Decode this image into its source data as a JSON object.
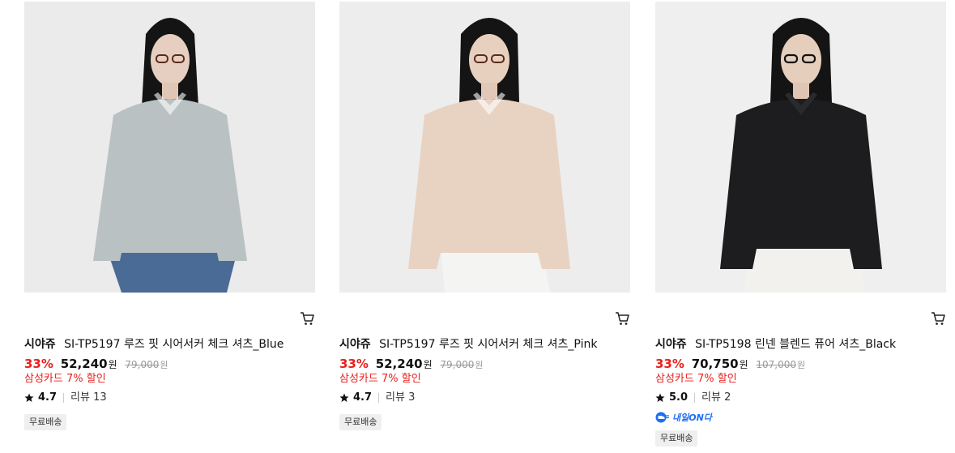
{
  "products": [
    {
      "brand": "시야쥬",
      "name": "SI-TP5197 루즈 핏 시어서커 체크 셔츠_Blue",
      "discount": "33%",
      "price": "52,240",
      "currency": "원",
      "original_price": "79,000",
      "original_currency": "원",
      "promo": "삼성카드 7% 할인",
      "rating": "4.7",
      "review_label": "리뷰",
      "review_count": "13",
      "badge": "무료배송",
      "shirt_color": "#b9c1c3",
      "pants_color": "#4a6b95"
    },
    {
      "brand": "시야쥬",
      "name": "SI-TP5197 루즈 핏 시어서커 체크 셔츠_Pink",
      "discount": "33%",
      "price": "52,240",
      "currency": "원",
      "original_price": "79,000",
      "original_currency": "원",
      "promo": "삼성카드 7% 할인",
      "rating": "4.7",
      "review_label": "리뷰",
      "review_count": "3",
      "badge": "무료배송",
      "shirt_color": "#e8d3c3",
      "pants_color": "#f4f4f2"
    },
    {
      "brand": "시야쥬",
      "name": "SI-TP5198 린넨 블렌드 퓨어 셔츠_Black",
      "discount": "33%",
      "price": "70,750",
      "currency": "원",
      "original_price": "107,000",
      "original_currency": "원",
      "promo": "삼성카드 7% 할인",
      "rating": "5.0",
      "review_label": "리뷰",
      "review_count": "2",
      "delivery_tag": "내일ON다",
      "delivery_icon": "truck-icon",
      "badge": "무료배송",
      "shirt_color": "#1d1d1f",
      "pants_color": "#f2f1ee"
    }
  ],
  "colors": {
    "discount": "#e8201c",
    "promo": "#e8201c",
    "delivery": "#1c6ef2",
    "badge_bg": "#efefef"
  },
  "icons": {
    "cart": "cart-icon",
    "star": "star-icon"
  }
}
